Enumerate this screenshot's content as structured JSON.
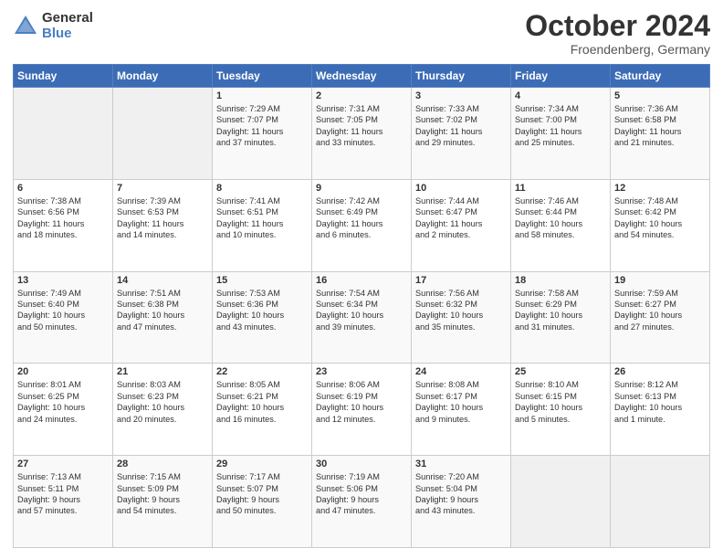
{
  "header": {
    "logo_general": "General",
    "logo_blue": "Blue",
    "month_title": "October 2024",
    "location": "Froendenberg, Germany"
  },
  "weekdays": [
    "Sunday",
    "Monday",
    "Tuesday",
    "Wednesday",
    "Thursday",
    "Friday",
    "Saturday"
  ],
  "weeks": [
    [
      {
        "day": "",
        "info": ""
      },
      {
        "day": "",
        "info": ""
      },
      {
        "day": "1",
        "info": "Sunrise: 7:29 AM\nSunset: 7:07 PM\nDaylight: 11 hours\nand 37 minutes."
      },
      {
        "day": "2",
        "info": "Sunrise: 7:31 AM\nSunset: 7:05 PM\nDaylight: 11 hours\nand 33 minutes."
      },
      {
        "day": "3",
        "info": "Sunrise: 7:33 AM\nSunset: 7:02 PM\nDaylight: 11 hours\nand 29 minutes."
      },
      {
        "day": "4",
        "info": "Sunrise: 7:34 AM\nSunset: 7:00 PM\nDaylight: 11 hours\nand 25 minutes."
      },
      {
        "day": "5",
        "info": "Sunrise: 7:36 AM\nSunset: 6:58 PM\nDaylight: 11 hours\nand 21 minutes."
      }
    ],
    [
      {
        "day": "6",
        "info": "Sunrise: 7:38 AM\nSunset: 6:56 PM\nDaylight: 11 hours\nand 18 minutes."
      },
      {
        "day": "7",
        "info": "Sunrise: 7:39 AM\nSunset: 6:53 PM\nDaylight: 11 hours\nand 14 minutes."
      },
      {
        "day": "8",
        "info": "Sunrise: 7:41 AM\nSunset: 6:51 PM\nDaylight: 11 hours\nand 10 minutes."
      },
      {
        "day": "9",
        "info": "Sunrise: 7:42 AM\nSunset: 6:49 PM\nDaylight: 11 hours\nand 6 minutes."
      },
      {
        "day": "10",
        "info": "Sunrise: 7:44 AM\nSunset: 6:47 PM\nDaylight: 11 hours\nand 2 minutes."
      },
      {
        "day": "11",
        "info": "Sunrise: 7:46 AM\nSunset: 6:44 PM\nDaylight: 10 hours\nand 58 minutes."
      },
      {
        "day": "12",
        "info": "Sunrise: 7:48 AM\nSunset: 6:42 PM\nDaylight: 10 hours\nand 54 minutes."
      }
    ],
    [
      {
        "day": "13",
        "info": "Sunrise: 7:49 AM\nSunset: 6:40 PM\nDaylight: 10 hours\nand 50 minutes."
      },
      {
        "day": "14",
        "info": "Sunrise: 7:51 AM\nSunset: 6:38 PM\nDaylight: 10 hours\nand 47 minutes."
      },
      {
        "day": "15",
        "info": "Sunrise: 7:53 AM\nSunset: 6:36 PM\nDaylight: 10 hours\nand 43 minutes."
      },
      {
        "day": "16",
        "info": "Sunrise: 7:54 AM\nSunset: 6:34 PM\nDaylight: 10 hours\nand 39 minutes."
      },
      {
        "day": "17",
        "info": "Sunrise: 7:56 AM\nSunset: 6:32 PM\nDaylight: 10 hours\nand 35 minutes."
      },
      {
        "day": "18",
        "info": "Sunrise: 7:58 AM\nSunset: 6:29 PM\nDaylight: 10 hours\nand 31 minutes."
      },
      {
        "day": "19",
        "info": "Sunrise: 7:59 AM\nSunset: 6:27 PM\nDaylight: 10 hours\nand 27 minutes."
      }
    ],
    [
      {
        "day": "20",
        "info": "Sunrise: 8:01 AM\nSunset: 6:25 PM\nDaylight: 10 hours\nand 24 minutes."
      },
      {
        "day": "21",
        "info": "Sunrise: 8:03 AM\nSunset: 6:23 PM\nDaylight: 10 hours\nand 20 minutes."
      },
      {
        "day": "22",
        "info": "Sunrise: 8:05 AM\nSunset: 6:21 PM\nDaylight: 10 hours\nand 16 minutes."
      },
      {
        "day": "23",
        "info": "Sunrise: 8:06 AM\nSunset: 6:19 PM\nDaylight: 10 hours\nand 12 minutes."
      },
      {
        "day": "24",
        "info": "Sunrise: 8:08 AM\nSunset: 6:17 PM\nDaylight: 10 hours\nand 9 minutes."
      },
      {
        "day": "25",
        "info": "Sunrise: 8:10 AM\nSunset: 6:15 PM\nDaylight: 10 hours\nand 5 minutes."
      },
      {
        "day": "26",
        "info": "Sunrise: 8:12 AM\nSunset: 6:13 PM\nDaylight: 10 hours\nand 1 minute."
      }
    ],
    [
      {
        "day": "27",
        "info": "Sunrise: 7:13 AM\nSunset: 5:11 PM\nDaylight: 9 hours\nand 57 minutes."
      },
      {
        "day": "28",
        "info": "Sunrise: 7:15 AM\nSunset: 5:09 PM\nDaylight: 9 hours\nand 54 minutes."
      },
      {
        "day": "29",
        "info": "Sunrise: 7:17 AM\nSunset: 5:07 PM\nDaylight: 9 hours\nand 50 minutes."
      },
      {
        "day": "30",
        "info": "Sunrise: 7:19 AM\nSunset: 5:06 PM\nDaylight: 9 hours\nand 47 minutes."
      },
      {
        "day": "31",
        "info": "Sunrise: 7:20 AM\nSunset: 5:04 PM\nDaylight: 9 hours\nand 43 minutes."
      },
      {
        "day": "",
        "info": ""
      },
      {
        "day": "",
        "info": ""
      }
    ]
  ]
}
